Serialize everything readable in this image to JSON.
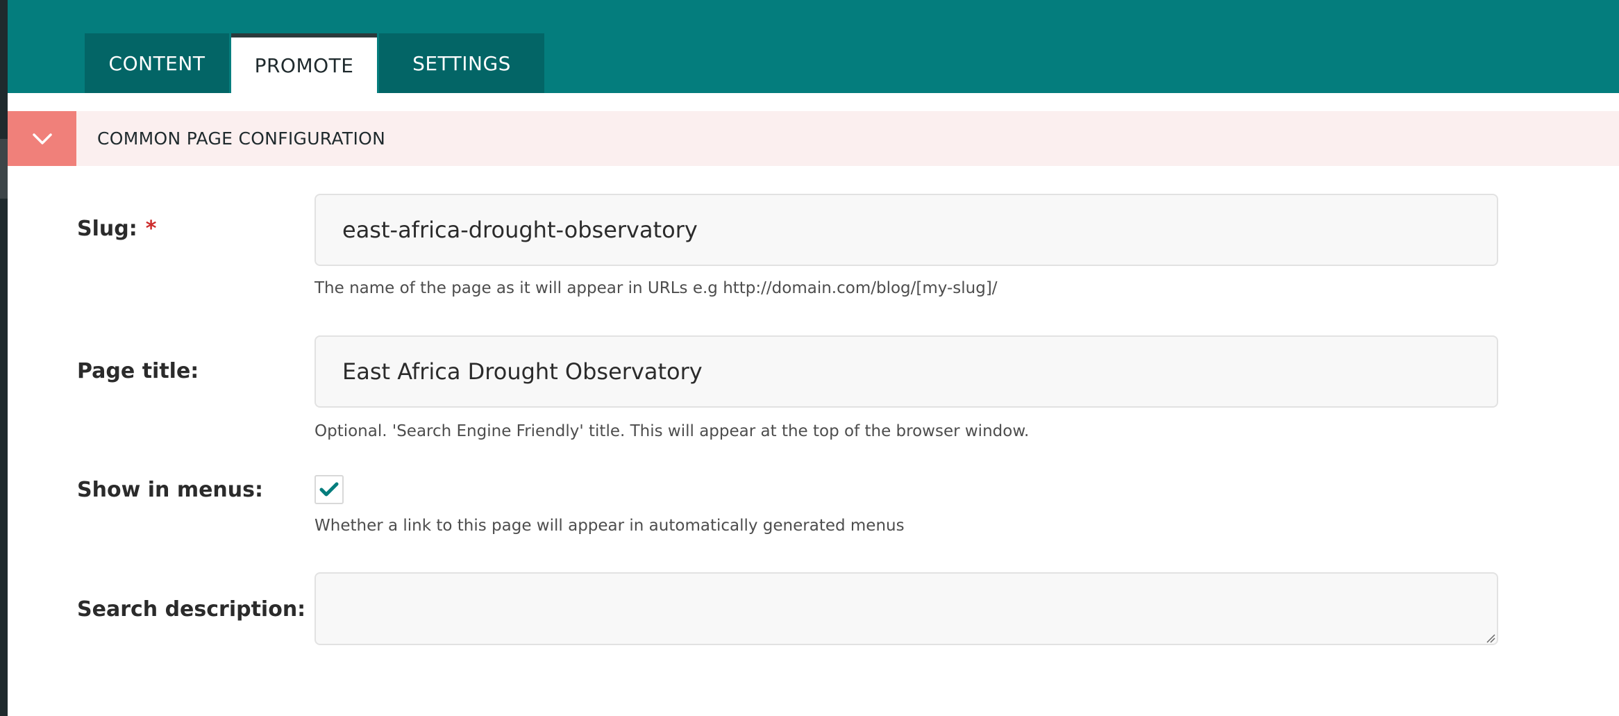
{
  "tabs": [
    {
      "label": "CONTENT"
    },
    {
      "label": "PROMOTE"
    },
    {
      "label": "SETTINGS"
    }
  ],
  "section": {
    "title": "COMMON PAGE CONFIGURATION",
    "toggle_icon": "chevron-down-icon"
  },
  "form": {
    "slug": {
      "label": "Slug:",
      "required_marker": "*",
      "value": "east-africa-drought-observatory",
      "help": "The name of the page as it will appear in URLs e.g http://domain.com/blog/[my-slug]/"
    },
    "page_title": {
      "label": "Page title:",
      "value": "East Africa Drought Observatory",
      "help": "Optional. 'Search Engine Friendly' title. This will appear at the top of the browser window."
    },
    "show_in_menus": {
      "label": "Show in menus:",
      "checked": true,
      "help": "Whether a link to this page will appear in automatically generated menus"
    },
    "search_description": {
      "label": "Search description:",
      "value": ""
    }
  },
  "colors": {
    "header": "#047d7d",
    "tab_inactive": "#036566",
    "section_bg": "#fbefef",
    "section_toggle": "#f0807a",
    "required": "#cd2c2c",
    "checkmark": "#047d7d"
  }
}
